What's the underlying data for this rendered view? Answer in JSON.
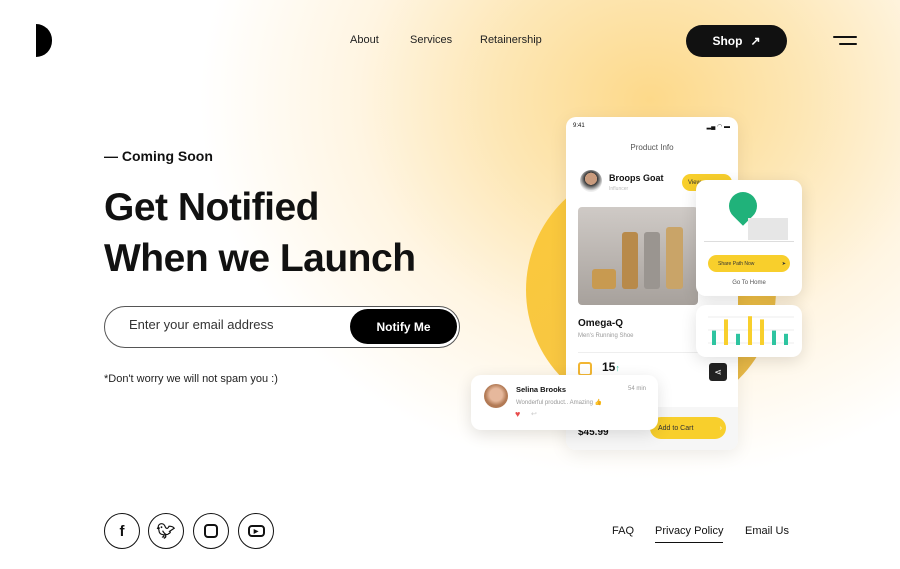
{
  "header": {
    "nav": [
      "About",
      "Services",
      "Retainership"
    ],
    "shop_label": "Shop",
    "shop_icon": "arrow-up-right-icon"
  },
  "hero": {
    "eyebrow": "— Coming Soon",
    "title_line1": "Get Notified",
    "title_line2": "When we Launch",
    "email_placeholder": "Enter your email address",
    "notify_label": "Notify Me",
    "note": "*Don't worry we will not spam you :)"
  },
  "mockup": {
    "time": "9:41",
    "screen_title": "Product Info",
    "user_name": "Broops Goat",
    "user_role": "Influncer",
    "view_label": "View",
    "product_name": "Omega-Q",
    "product_sub": "Men's Running Shoe",
    "points": "15",
    "price": "$45.99",
    "cart_label": "Add to Cart",
    "map_card": {
      "button": "Share Path Now",
      "link": "Go To Home"
    },
    "comment": {
      "name": "Selina Brooks",
      "time": "54 min",
      "text": "Wonderful product.. Amazing 👍"
    },
    "bar_colors": [
      "#2ec4a0",
      "#f8cf2c",
      "#2ec4a0",
      "#f8cf2c",
      "#f8cf2c",
      "#2ec4a0",
      "#2ec4a0"
    ],
    "bar_values": [
      0.45,
      0.8,
      0.35,
      0.9,
      0.8,
      0.45,
      0.35
    ]
  },
  "footer": {
    "social": [
      "facebook-icon",
      "twitter-icon",
      "instagram-icon",
      "youtube-icon"
    ],
    "links": [
      "FAQ",
      "Privacy Policy",
      "Email Us"
    ]
  },
  "colors": {
    "accent": "#f8cf2c",
    "dark": "#111111",
    "teal": "#2ec4a0"
  }
}
